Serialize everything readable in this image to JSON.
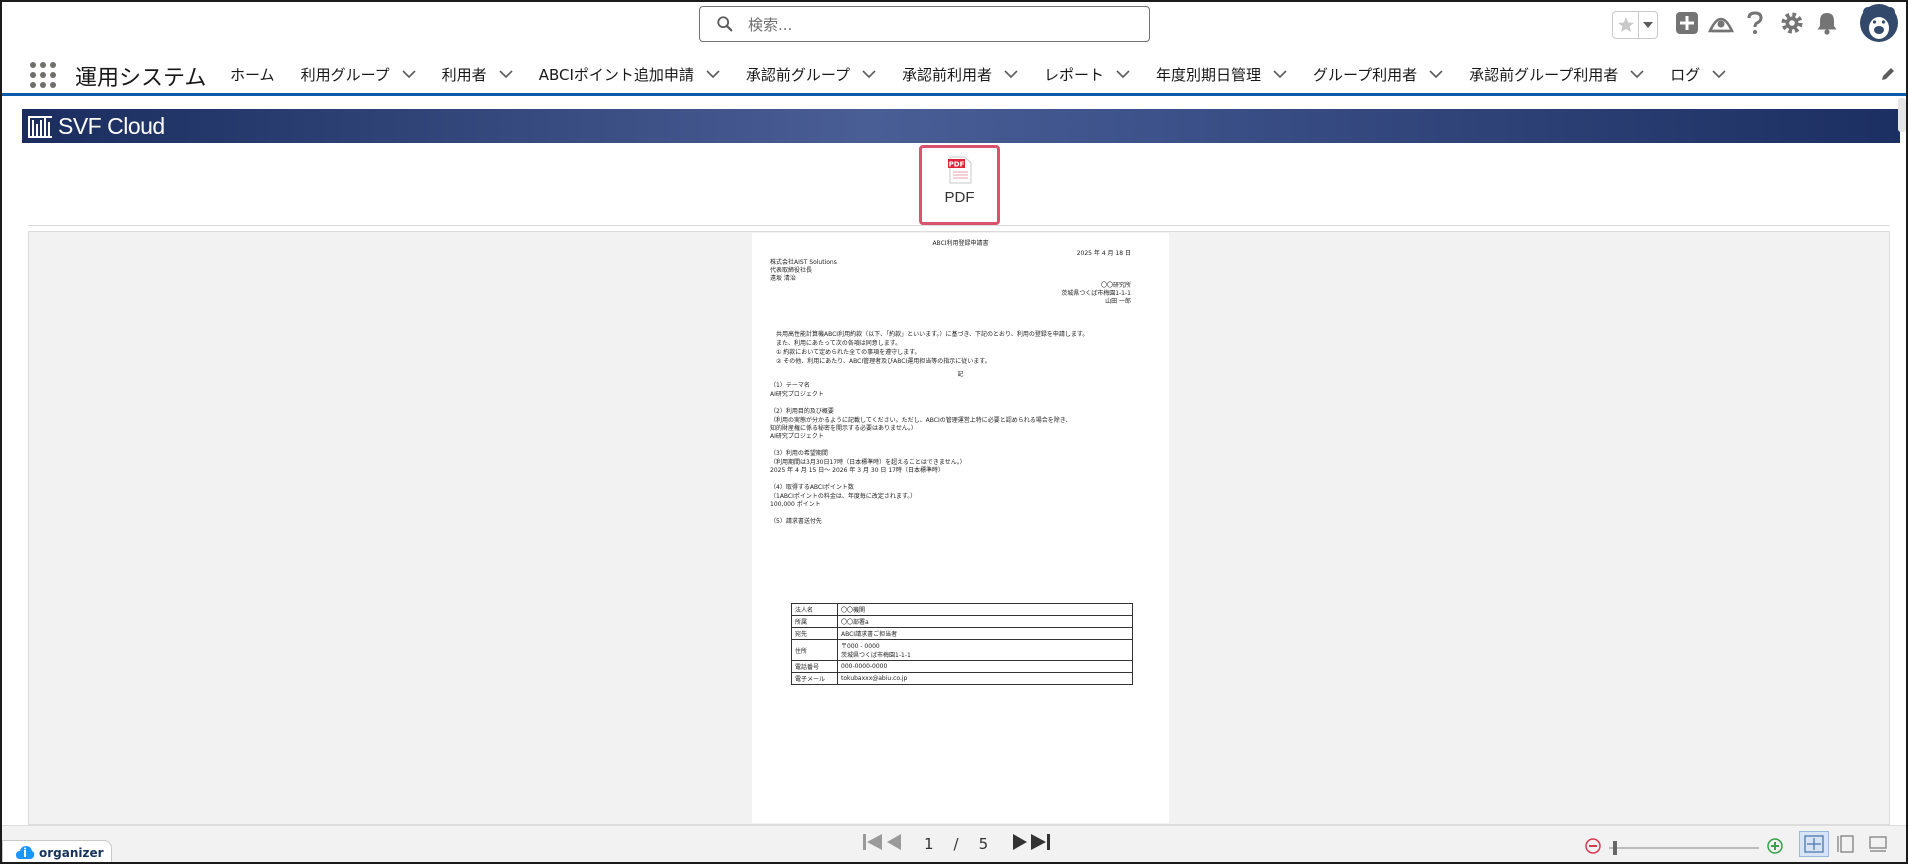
{
  "header": {
    "search_placeholder": "検索...",
    "icons": [
      "star-icon",
      "chevron-down-icon",
      "add-icon",
      "trailhead-icon",
      "help-icon",
      "gear-icon",
      "bell-icon",
      "avatar"
    ]
  },
  "nav": {
    "app_name": "運用システム",
    "items": [
      {
        "label": "ホーム",
        "dropdown": false
      },
      {
        "label": "利用グループ",
        "dropdown": true
      },
      {
        "label": "利用者",
        "dropdown": true
      },
      {
        "label": "ABCIポイント追加申請",
        "dropdown": true
      },
      {
        "label": "承認前グループ",
        "dropdown": true
      },
      {
        "label": "承認前利用者",
        "dropdown": true
      },
      {
        "label": "レポート",
        "dropdown": true
      },
      {
        "label": "年度別期日管理",
        "dropdown": true
      },
      {
        "label": "グループ利用者",
        "dropdown": true
      },
      {
        "label": "承認前グループ利用者",
        "dropdown": true
      },
      {
        "label": "ログ",
        "dropdown": true
      }
    ]
  },
  "banner": {
    "logo_text": "SVF Cloud"
  },
  "pdf_button": {
    "label": "PDF",
    "icon_text": "PDF"
  },
  "document": {
    "title": "ABCI利用登録申請書",
    "date": "2025 年  4 月 18 日",
    "addressee": [
      "株式会社AIST Solutions",
      "  代表取締役社長",
      "  遠坂 清治"
    ],
    "applicant": [
      "〇〇研究所",
      "茨城県つくば市梅園1-1-1",
      "山田 一郎"
    ],
    "intro": [
      "共用高性能計算機ABCI利用約款（以下、「約款」といいます。）に基づき、下記のとおり、利用の登録を申請します。",
      "また、利用にあたって次の各項は同意します。",
      "① 約款において定められた全ての事項を遵守します。",
      "② その他、利用にあたり、ABCI管理者及びABCI運用担当等の指示に従います。"
    ],
    "ki": "記",
    "sections": [
      {
        "heading": "（1）テーマ名",
        "lines": [
          "   AI研究プロジェクト"
        ]
      },
      {
        "heading": "（2）利用目的及び概要",
        "lines": [
          "  （利用の実態が分かるように記載してください。ただし、ABCIの管理運営上特に必要と認められる場合を除き、",
          "   知的財産権に係る秘密を開示する必要はありません。）",
          "   AI研究プロジェクト"
        ]
      },
      {
        "heading": "（3）利用の希望期間",
        "lines": [
          "  （利用期間は3月30日17時（日本標準時）を超えることはできません。）",
          "   2025 年  4 月 15 日～  2026 年  3 月 30 日  17時（日本標準時）"
        ]
      },
      {
        "heading": "（4）取得するABCIポイント数",
        "lines": [
          "  （1ABCIポイントの料金は、年度毎に改定されます。）",
          "   100,000 ポイント"
        ]
      },
      {
        "heading": "（5）請求書送付先",
        "lines": []
      }
    ],
    "billing_table": [
      {
        "key": "法人名",
        "value": "〇〇機関"
      },
      {
        "key": "所属",
        "value": "〇〇部署a"
      },
      {
        "key": "宛先",
        "value": "ABCI請求書ご担当者"
      },
      {
        "key": "住所",
        "value": "〒000 - 0000\n茨城県つくば市梅園1-1-1"
      },
      {
        "key": "電話番号",
        "value": "000-0000-0000"
      },
      {
        "key": "電子メール",
        "value": "tokubaxxx@abiu.co.jp"
      }
    ]
  },
  "pager": {
    "current": "1",
    "separator": "/",
    "total": "5"
  },
  "zoom": {
    "level_fraction": 0.03
  },
  "organizer": {
    "label": "organizer"
  }
}
